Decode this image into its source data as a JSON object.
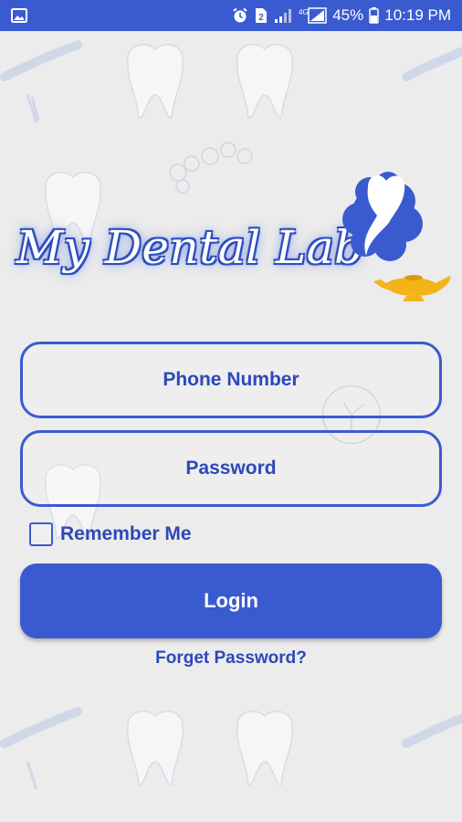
{
  "status_bar": {
    "battery_percent": "45%",
    "time": "10:19 PM",
    "network": "4G",
    "notification_count": "2",
    "icons": [
      "image-icon",
      "alarm-icon",
      "sim-2-icon",
      "signal-icon",
      "signal-4g-icon",
      "battery-icon"
    ]
  },
  "logo": {
    "title": "My Dental Lab"
  },
  "form": {
    "phone_placeholder": "Phone Number",
    "password_placeholder": "Password",
    "remember_label": "Remember Me",
    "remember_checked": false,
    "login_label": "Login",
    "forgot_label": "Forget Password?"
  },
  "colors": {
    "accent": "#3a5bd0",
    "text": "#2d48b8",
    "background": "#ececec",
    "lamp": "#f2b418"
  }
}
